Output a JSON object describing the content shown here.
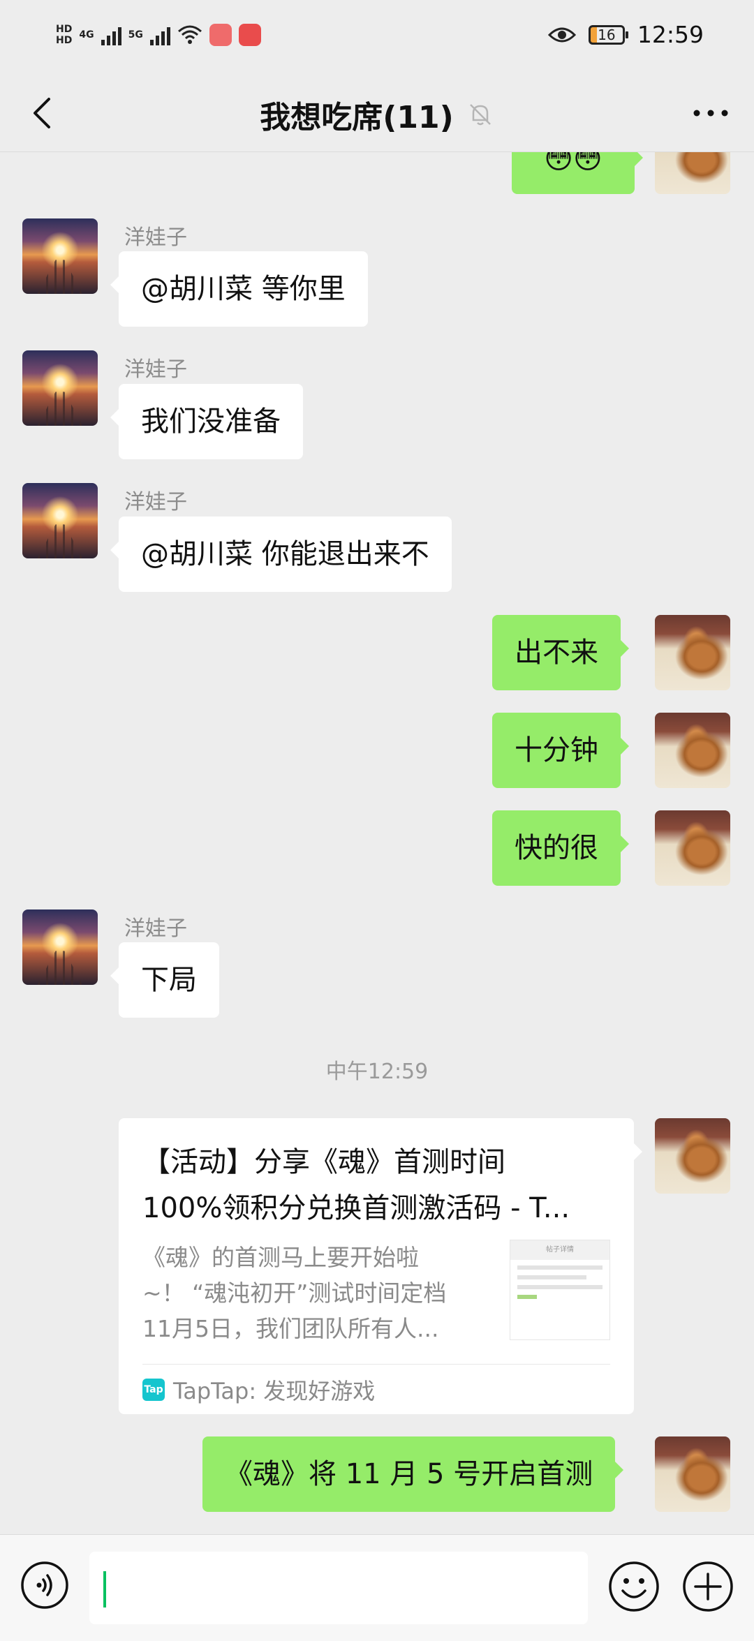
{
  "status_bar": {
    "hd1": "HD",
    "hd2": "HD",
    "net1": "4G",
    "net2": "5G",
    "battery": "16",
    "time": "12:59"
  },
  "nav": {
    "title": "我想吃席(11)"
  },
  "messages": [
    {
      "side": "left",
      "sender": "洋娃子",
      "text": "@胡川菜  等你里"
    },
    {
      "side": "left",
      "sender": "洋娃子",
      "text": "我们没准备"
    },
    {
      "side": "left",
      "sender": "洋娃子",
      "text": "@胡川菜  你能退出来不"
    },
    {
      "side": "right",
      "text": "出不来"
    },
    {
      "side": "right",
      "text": "十分钟"
    },
    {
      "side": "right",
      "text": "快的很"
    },
    {
      "side": "left",
      "sender": "洋娃子",
      "text": "下局"
    }
  ],
  "top_partial_emoji": "😳😳",
  "time_divider": "中午12:59",
  "link_card": {
    "title_line1": "【活动】分享《魂》首测时间",
    "title_line2": "100%领积分兑换首测激活码 - T...",
    "desc_line1": "《魂》的首测马上要开始啦",
    "desc_line2": "~！ “魂沌初开”测试时间定档",
    "desc_line3": "11月5日，我们团队所有人...",
    "thumb_header": "帖子详情",
    "source_logo": "Tap",
    "source": "TapTap: 发现好游戏"
  },
  "last_message": "《魂》将 11 月 5 号开启首测",
  "colors": {
    "background": "#ededed",
    "bubble_self": "#95ec69",
    "bubble_other": "#ffffff",
    "caret": "#07c160"
  },
  "icons": {
    "back": "chevron-left-icon",
    "mute": "bell-muted-icon",
    "more": "more-dots-icon",
    "voice": "voice-icon",
    "emoji": "emoji-icon",
    "plus": "plus-icon"
  }
}
